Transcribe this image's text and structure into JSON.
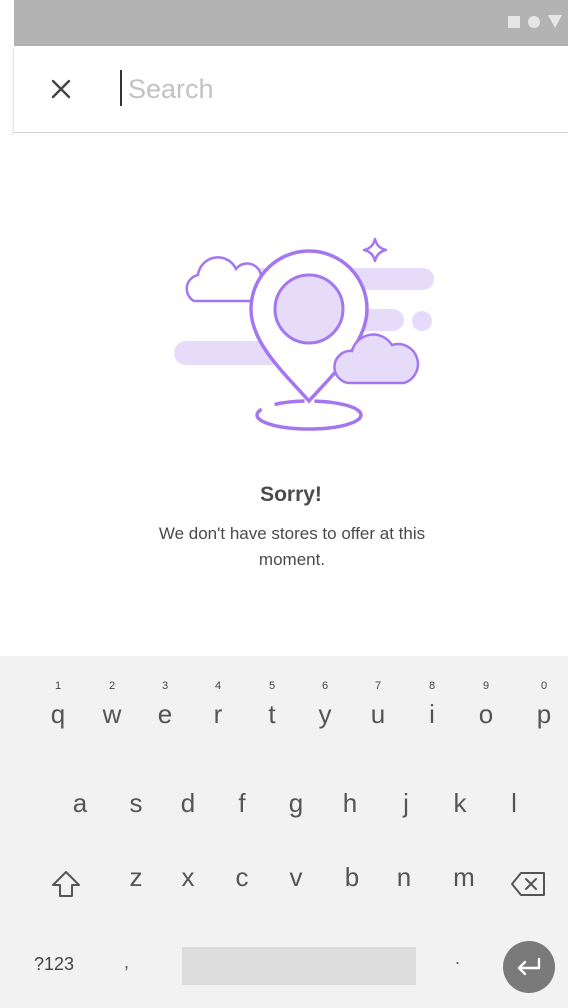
{
  "search": {
    "placeholder": "Search",
    "value": ""
  },
  "empty_state": {
    "title": "Sorry!",
    "message": "We don't have stores to offer at this moment."
  },
  "colors": {
    "accent": "#a476f0",
    "accent_light": "#e6dcfa",
    "status_bar": "#b3b3b3",
    "keyboard_bg": "#f2f2f2"
  },
  "keyboard": {
    "row1": [
      {
        "hint": "1",
        "char": "q"
      },
      {
        "hint": "2",
        "char": "w"
      },
      {
        "hint": "3",
        "char": "e"
      },
      {
        "hint": "4",
        "char": "r"
      },
      {
        "hint": "5",
        "char": "t"
      },
      {
        "hint": "6",
        "char": "y"
      },
      {
        "hint": "7",
        "char": "u"
      },
      {
        "hint": "8",
        "char": "i"
      },
      {
        "hint": "9",
        "char": "o"
      },
      {
        "hint": "0",
        "char": "p"
      }
    ],
    "row2": [
      "a",
      "s",
      "d",
      "f",
      "g",
      "h",
      "j",
      "k",
      "l"
    ],
    "row3": [
      "z",
      "x",
      "c",
      "v",
      "b",
      "n",
      "m"
    ],
    "symbols_label": "?123",
    "comma_label": ",",
    "period_label": ".",
    "icons": {
      "shift": "shift-icon",
      "backspace": "backspace-icon",
      "enter": "enter-icon",
      "close": "close-icon"
    }
  }
}
